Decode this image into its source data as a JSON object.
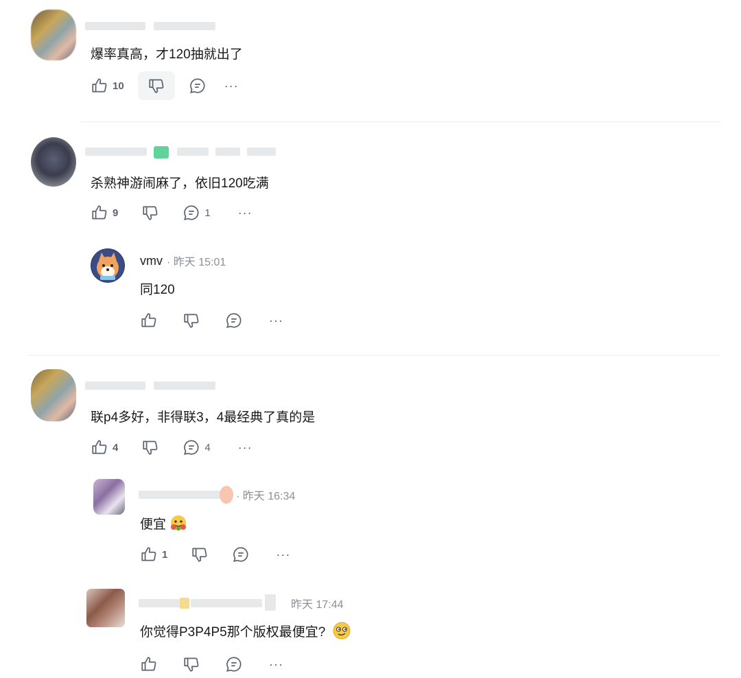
{
  "comments": [
    {
      "text": "爆率真高，才120抽就出了",
      "likes": "10",
      "replies_count": ""
    },
    {
      "text": "杀熟神游闹麻了，依旧120吃满",
      "likes": "9",
      "replies_count": "1",
      "replies": [
        {
          "username": "vmv",
          "time": "· 昨天 15:01",
          "text": "同120",
          "likes": ""
        }
      ]
    },
    {
      "text": "联p4多好，非得联3，4最经典了真的是",
      "likes": "4",
      "replies_count": "4",
      "replies": [
        {
          "time": "· 昨天 16:34",
          "text": "便宜",
          "likes": "1"
        },
        {
          "time": "昨天 17:44",
          "text": "你觉得P3P4P5那个版权最便宜?",
          "likes": ""
        }
      ]
    }
  ],
  "icons": {
    "like": "thumbs-up-icon",
    "dislike": "thumbs-down-icon",
    "reply": "comment-bubble-icon",
    "more": "more-dots-icon"
  },
  "more_label": "···",
  "colors": {
    "icon": "#5c6370",
    "meta": "#8a8f99",
    "divider": "#ececee"
  }
}
